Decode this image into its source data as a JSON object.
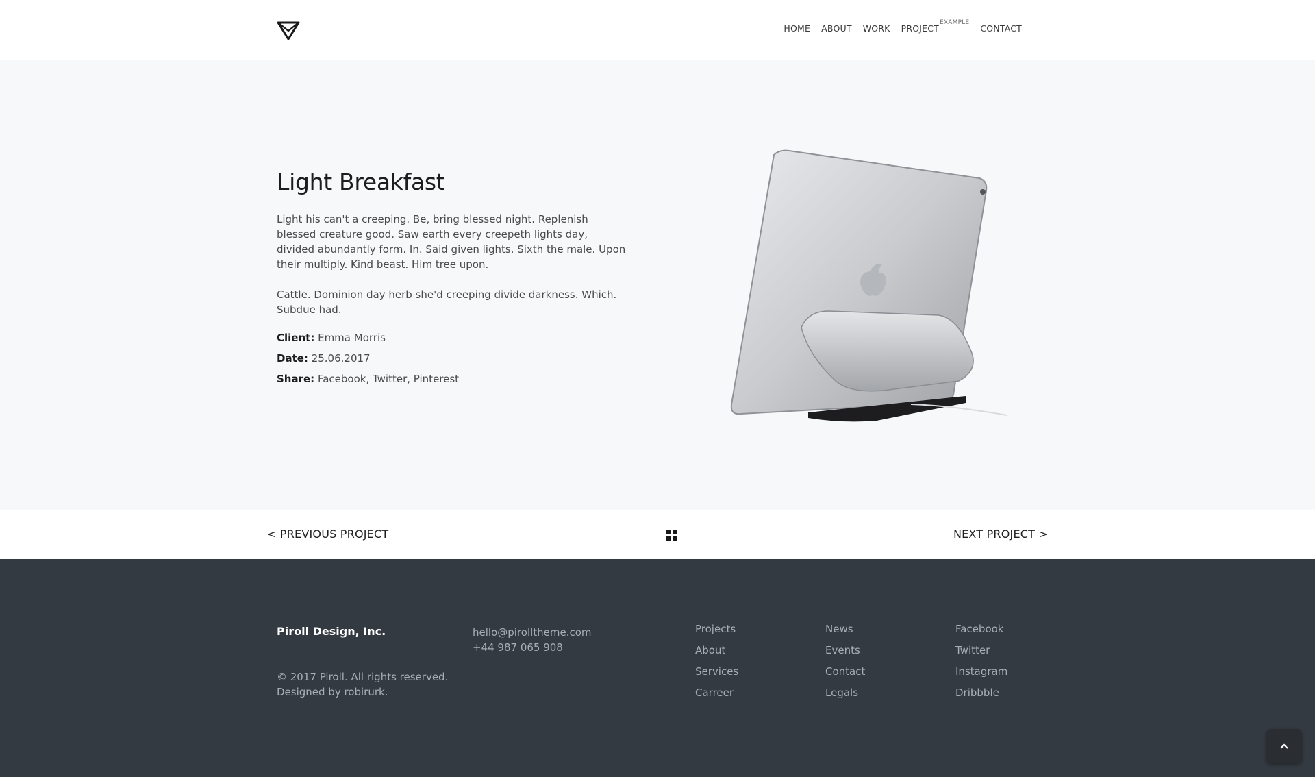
{
  "header": {
    "logo": "triangle-logo",
    "nav": [
      {
        "label": "HOME"
      },
      {
        "label": "ABOUT"
      },
      {
        "label": "WORK"
      },
      {
        "label": "PROJECT",
        "sup": "EXAMPLE"
      },
      {
        "label": "CONTACT"
      }
    ]
  },
  "project": {
    "title": "Light Breakfast",
    "paragraph1": "Light his can't a creeping. Be, bring blessed night. Replenish blessed creature good. Saw earth every creepeth lights day, divided abundantly form. In. Said given lights. Sixth the male. Upon their multiply. Kind beast. Him tree upon.",
    "paragraph2": "Cattle. Dominion day herb she'd creeping divide darkness. Which. Subdue had.",
    "client_label": "Client:",
    "client": "Emma Morris",
    "date_label": "Date:",
    "date": "25.06.2017",
    "share_label": "Share:",
    "share": "Facebook, Twitter, Pinterest",
    "image": "tablet-on-stand-photo"
  },
  "project_nav": {
    "previous": "< PREVIOUS PROJECT",
    "next": "NEXT PROJECT >",
    "grid_icon": "grid-icon"
  },
  "footer": {
    "brand": "Piroll Design, Inc.",
    "copyright": "© 2017 Piroll. All rights reserved.",
    "designed_by": "Designed by robirurk.",
    "email": "hello@pirolltheme.com",
    "phone": "+44 987 065 908",
    "col1": [
      "Projects",
      "About",
      "Services",
      "Carreer"
    ],
    "col2": [
      "News",
      "Events",
      "Contact",
      "Legals"
    ],
    "col3": [
      "Facebook",
      "Twitter",
      "Instagram",
      "Dribbble"
    ]
  },
  "scroll_top_icon": "chevron-up-icon",
  "colors": {
    "hero_bg": "#f7f8f9",
    "footer_bg": "#343a42",
    "text": "#1f1f1f",
    "footer_text": "#a9aeb5"
  }
}
